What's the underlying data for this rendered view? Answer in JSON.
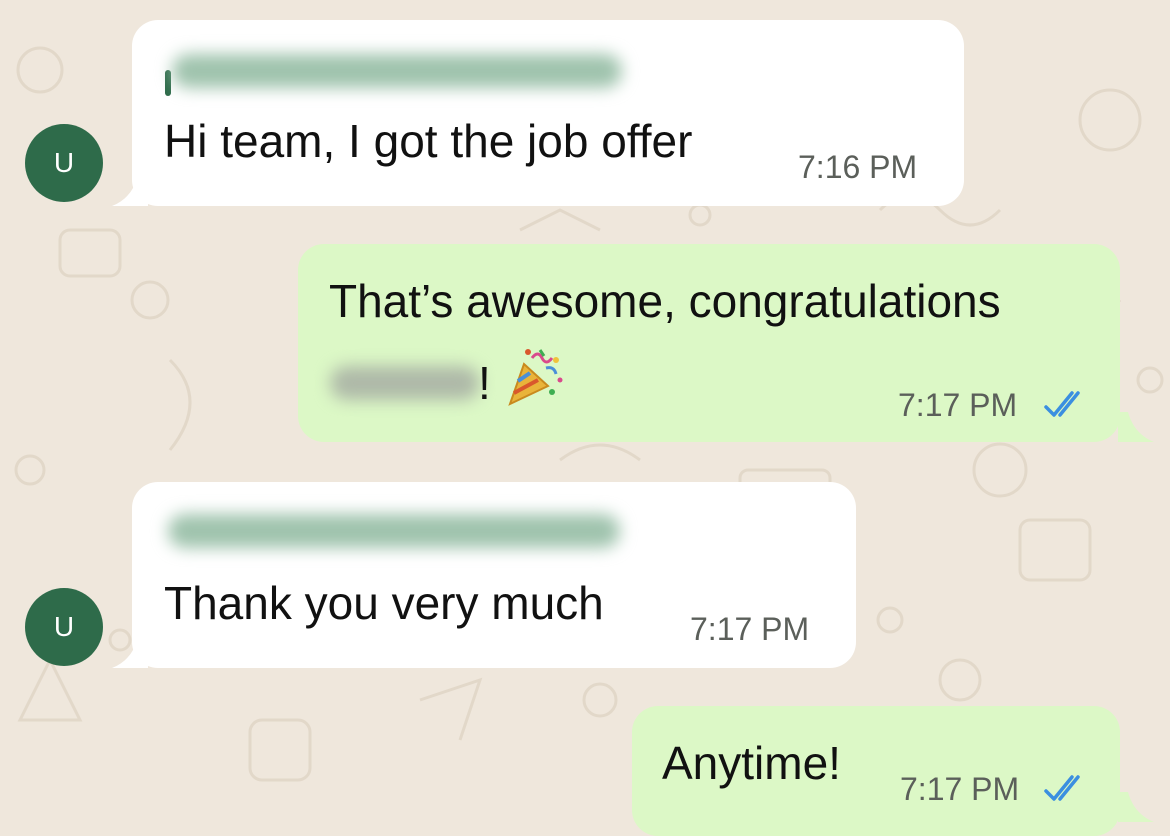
{
  "colors": {
    "wallpaper": "#efe7dc",
    "incoming_bubble": "#ffffff",
    "outgoing_bubble": "#dcf8c6",
    "avatar": "#2e6b4a",
    "read_ticks": "#3b8fe0"
  },
  "messages": [
    {
      "direction": "incoming",
      "avatar_initial": "U",
      "sender_name_blurred": true,
      "text": "Hi team, I got the job offer",
      "time": "7:16 PM"
    },
    {
      "direction": "outgoing",
      "text": "That’s awesome, congratulations",
      "text_line2_blurred_name": true,
      "text_line2_suffix": "!",
      "emoji": "party-popper-icon",
      "time": "7:17 PM",
      "status": "read"
    },
    {
      "direction": "incoming",
      "avatar_initial": "U",
      "sender_name_blurred": true,
      "text": "Thank you very much",
      "time": "7:17 PM"
    },
    {
      "direction": "outgoing",
      "text": "Anytime!",
      "time": "7:17 PM",
      "status": "read"
    }
  ]
}
